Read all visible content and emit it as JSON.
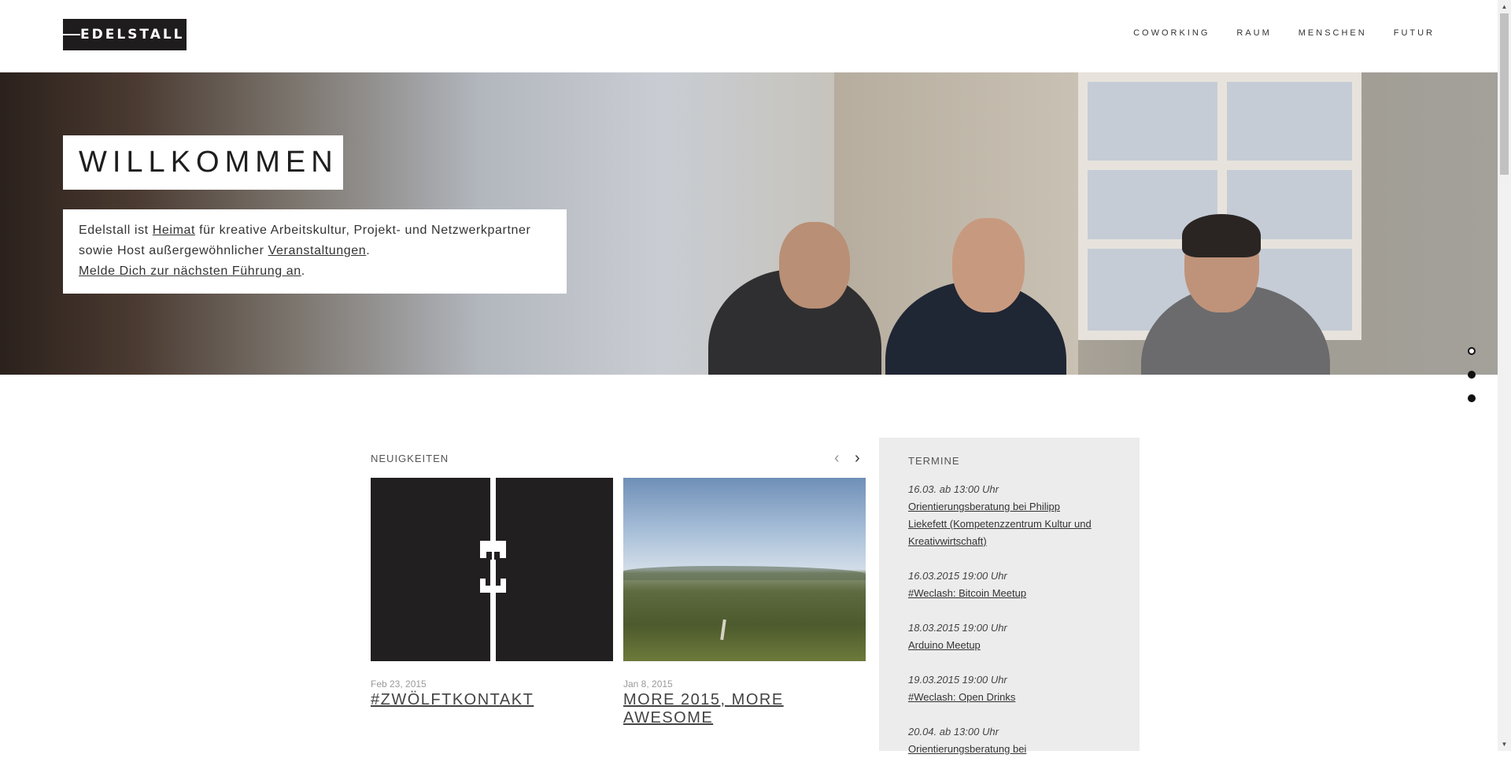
{
  "header": {
    "logo": "EDELSTALL",
    "nav": [
      "COWORKING",
      "RAUM",
      "MENSCHEN",
      "FUTUR"
    ]
  },
  "hero": {
    "title": "WILLKOMMEN",
    "intro": {
      "part1": "Edelstall ist ",
      "link_heimat": "Heimat",
      "part2": " für kreative Arbeitskultur, Projekt- und Netzwerkpartner sowie Host außergewöhnlicher ",
      "link_veranstaltungen": "Veranstaltungen",
      "part3": ".",
      "link_fuehrung": "Melde Dich zur nächsten Führung an",
      "part4": "."
    },
    "slides_total": 3,
    "active_slide": 1
  },
  "news": {
    "heading": "NEUIGKEITEN",
    "prev_icon": "chevron-left-icon",
    "next_icon": "chevron-right-icon",
    "prev_glyph": "‹",
    "next_glyph": "›",
    "items": [
      {
        "date": "Feb 23, 2015",
        "title": "#ZWÖLFTKONTAKT"
      },
      {
        "date": "Jan 8, 2015",
        "title": "MORE 2015, MORE AWESOME"
      }
    ]
  },
  "termine": {
    "heading": "TERMINE",
    "events": [
      {
        "when": "16.03. ab 13:00 Uhr",
        "what": "Orientierungsberatung bei Philipp Liekefett (Kompetenzzentrum Kultur und Kreativwirtschaft)"
      },
      {
        "when": "16.03.2015 19:00 Uhr",
        "what": "#Weclash: Bitcoin Meetup"
      },
      {
        "when": "18.03.2015 19:00 Uhr",
        "what": "Arduino Meetup"
      },
      {
        "when": "19.03.2015 19:00 Uhr",
        "what": "#Weclash: Open Drinks"
      },
      {
        "when": "20.04. ab 13:00 Uhr",
        "what": "Orientierungsberatung bei"
      }
    ]
  }
}
